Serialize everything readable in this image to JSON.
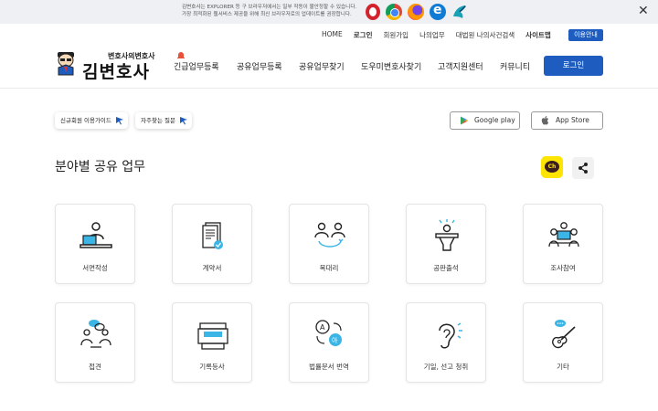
{
  "notice": {
    "line1": "김변호사는 EXPLORER 등 구 브라우저에서는 일부 작동이 불안정할 수 있습니다.",
    "line2": "가장 최적화된 웹서비스 제공을 위해 최신 브라우저로의 업데이트를 권장합니다.",
    "close": "✕"
  },
  "util_menu": [
    "HOME",
    "로그인",
    "회원가입",
    "나의업무",
    "대법원 나의사건검색",
    "사이트맵"
  ],
  "util_button": "이용안내",
  "logo": {
    "sub": "변호사의변호사",
    "main": "김변호사"
  },
  "gnb": [
    "긴급업무등록",
    "공유업무등록",
    "공유업무찾기",
    "도우미변호사찾기",
    "고객지원센터",
    "커뮤니티"
  ],
  "login_button": "로그인",
  "pills": [
    "신규회원 이용가이드",
    "자주찾는 질문"
  ],
  "stores": [
    "Google play",
    "App Store"
  ],
  "section_title": "분야별 공유 업무",
  "kakao_label": "Ch",
  "categories": [
    {
      "label": "서면작성",
      "icon": "laptop-writer-icon"
    },
    {
      "label": "계약서",
      "icon": "contract-document-icon"
    },
    {
      "label": "복대리",
      "icon": "substitute-agent-icon"
    },
    {
      "label": "공판출석",
      "icon": "court-attendance-icon"
    },
    {
      "label": "조사참여",
      "icon": "investigation-icon"
    },
    {
      "label": "접견",
      "icon": "meeting-icon"
    },
    {
      "label": "기록등사",
      "icon": "copy-machine-icon"
    },
    {
      "label": "법률문서 번역",
      "icon": "translation-icon"
    },
    {
      "label": "기일, 선고 청취",
      "icon": "hearing-ear-icon"
    },
    {
      "label": "기타",
      "icon": "guitar-icon"
    }
  ],
  "colors": {
    "accent": "#1e5dbf",
    "teal": "#3ab5e6",
    "kakao": "#fee500"
  }
}
